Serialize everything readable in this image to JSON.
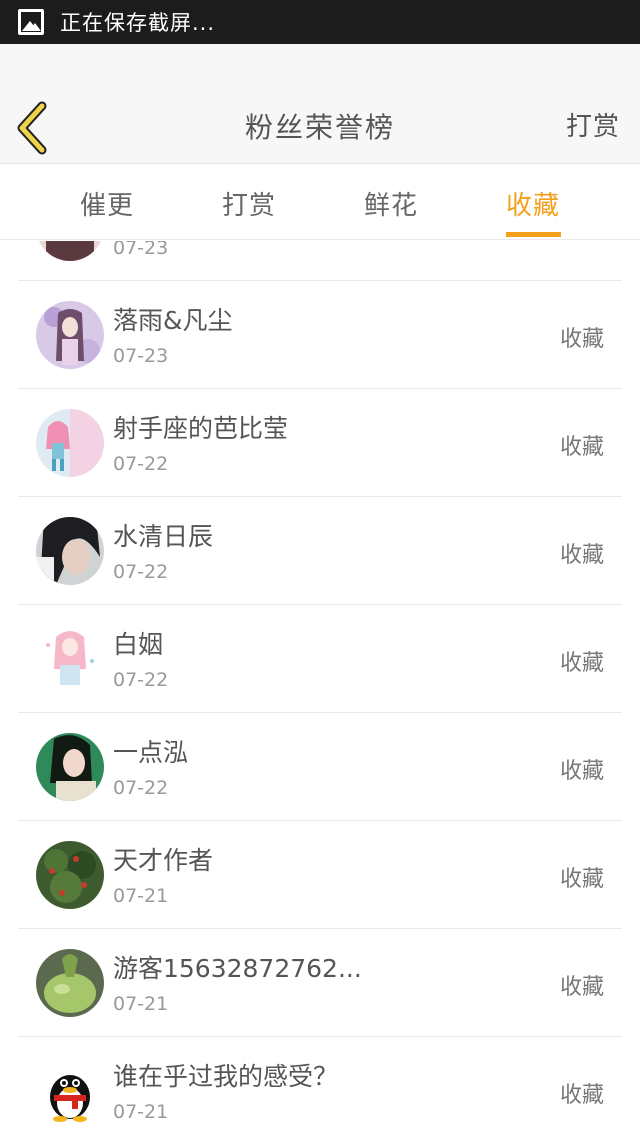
{
  "status_bar": {
    "text": "正在保存截屏..."
  },
  "header": {
    "title": "粉丝荣誉榜",
    "right_action": "打赏"
  },
  "tabs": [
    {
      "label": "催更"
    },
    {
      "label": "打赏"
    },
    {
      "label": "鲜花"
    },
    {
      "label": "收藏",
      "active": true
    }
  ],
  "colors": {
    "accent": "#f4a01c",
    "status_bar": "#1c1c1c"
  },
  "entries": [
    {
      "name": "",
      "date": "07-23",
      "action": ""
    },
    {
      "name": "落雨&凡尘",
      "date": "07-23",
      "action": "收藏"
    },
    {
      "name": "射手座的芭比莹",
      "date": "07-22",
      "action": "收藏"
    },
    {
      "name": "水清日辰",
      "date": "07-22",
      "action": "收藏"
    },
    {
      "name": "白姻",
      "date": "07-22",
      "action": "收藏"
    },
    {
      "name": "一点泓",
      "date": "07-22",
      "action": "收藏"
    },
    {
      "name": "天才作者",
      "date": "07-21",
      "action": "收藏"
    },
    {
      "name": "游客15632872762...",
      "date": "07-21",
      "action": "收藏"
    },
    {
      "name": "谁在乎过我的感受？",
      "date": "07-21",
      "action": "收藏"
    }
  ]
}
